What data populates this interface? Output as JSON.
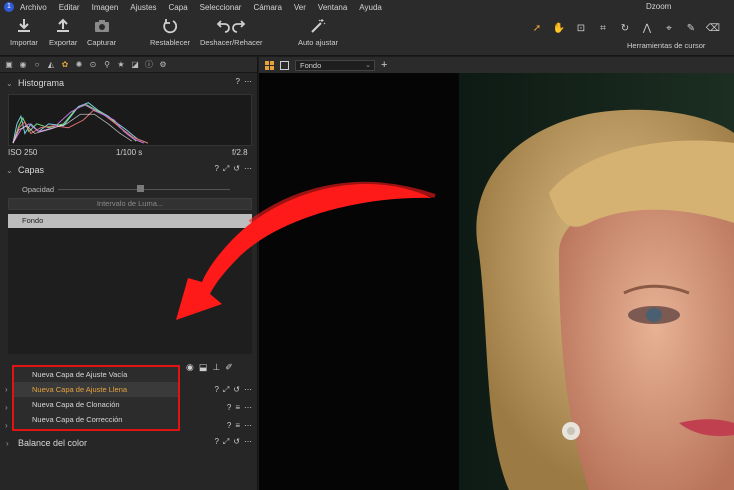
{
  "app": {
    "title": "Dzoom",
    "logo": "1"
  },
  "menu": [
    "Archivo",
    "Editar",
    "Imagen",
    "Ajustes",
    "Capa",
    "Seleccionar",
    "Cámara",
    "Ver",
    "Ventana",
    "Ayuda"
  ],
  "toolbar": {
    "import": "Importar",
    "export": "Exportar",
    "capture": "Capturar",
    "reset": "Restablecer",
    "undo_redo": "Deshacer/Rehacer",
    "auto_adjust": "Auto ajustar",
    "cursor_tools": "Herramientas de cursor"
  },
  "panels": {
    "histogram": {
      "title": "Histograma",
      "iso": "ISO 250",
      "shutter": "1/100 s",
      "aperture": "f/2.8"
    },
    "layers": {
      "title": "Capas",
      "opacity_label": "Opacidad",
      "luma_button": "Intervalo de Luma...",
      "layer_name": "Fondo"
    },
    "color_balance": {
      "title": "Balance del color"
    }
  },
  "context_menu": {
    "items": [
      "Nueva Capa de Ajuste Vacía",
      "Nueva Capa de Ajuste Llena",
      "Nueva Capa de Clonación",
      "Nueva Capa de Corrección"
    ],
    "highlighted_index": 1
  },
  "viewer": {
    "variant": "Fondo"
  },
  "icons": {
    "import": "download-icon",
    "export": "upload-icon",
    "capture": "camera-icon",
    "reset": "reset-icon",
    "undo": "undo-icon",
    "auto": "magic-wand-icon"
  },
  "colors": {
    "accent": "#e8a23a",
    "annotation": "#e01414",
    "highlight_layer": "#bdbdbd"
  }
}
